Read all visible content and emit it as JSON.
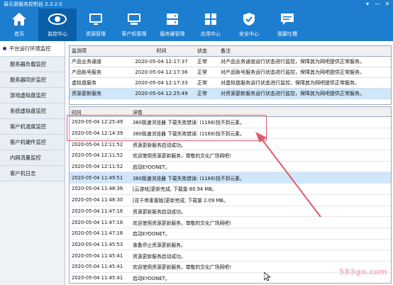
{
  "app": {
    "title": "易乐游服务控制台 2.3.2.0",
    "window_controls": [
      "▾",
      "—",
      "✕"
    ]
  },
  "nav": [
    {
      "label": "首页",
      "icon": "home-icon",
      "active": false
    },
    {
      "label": "监控中心",
      "icon": "eye-icon",
      "active": true
    },
    {
      "label": "资源管理",
      "icon": "monitor-icon",
      "active": false
    },
    {
      "label": "客户机管理",
      "icon": "computer-icon",
      "active": false
    },
    {
      "label": "服务器管理",
      "icon": "server-icon",
      "active": false
    },
    {
      "label": "应用中心",
      "icon": "apps-icon",
      "active": false
    },
    {
      "label": "安全中心",
      "icon": "shield-icon",
      "active": false
    },
    {
      "label": "我要吐槽",
      "icon": "chat-icon",
      "active": false
    }
  ],
  "sidebar": {
    "items": [
      {
        "label": "平台运行环境监控",
        "active": true
      },
      {
        "label": "服务器负载监控",
        "active": false
      },
      {
        "label": "服务器同步监控",
        "active": false
      },
      {
        "label": "游戏虚拟盘监控",
        "active": false
      },
      {
        "label": "系统虚拟盘监控",
        "active": false
      },
      {
        "label": "客户机温度监控",
        "active": false
      },
      {
        "label": "客户机硬件监控",
        "active": false
      },
      {
        "label": "内网流量监控",
        "active": false
      },
      {
        "label": "客户机日志",
        "active": false
      }
    ]
  },
  "monitor_table": {
    "headers": [
      "监测项",
      "时间",
      "状态",
      "备注"
    ],
    "rows": [
      [
        "产品业务通道",
        "2020-05-04 12:17:37",
        "正常",
        "对产品业务通道运行状态进行监控，保障其为网吧提供正常服务。"
      ],
      [
        "产品账号服务",
        "2020-05-04 12:17:36",
        "正常",
        "对产品账号服务运行状态进行监控，保障其为网吧提供正常服务。"
      ],
      [
        "虚拟盘服务",
        "2020-05-04 12:17:33",
        "正常",
        "对虚拟盘服务运行状态进行监控，保障其为网吧提供正常服务。"
      ],
      [
        "资源更新服务",
        "2020-05-04 12:25:49",
        "正常",
        "对资源更新服务运行状态进行监控，保障其为网吧提供正常服务。"
      ]
    ],
    "selected_row": 3
  },
  "log_table": {
    "headers": [
      "时间",
      "详情"
    ],
    "rows": [
      [
        "2020-05-04 12:25:49",
        "360极速浏览器 下载失败错误: (1168)找不到元素。"
      ],
      [
        "2020-05-04 12:14:39",
        "360极速浏览器 下载失败错误: (1168)找不到元素。"
      ],
      [
        "2020-05-04 12:11:52",
        "资源更新服务启动成功。"
      ],
      [
        "2020-05-04 12:11:52",
        "欢迎使用资源更新服务，尊敬的文化广场网吧!"
      ],
      [
        "2020-05-04 12:11:52",
        "启动EYOONET。"
      ],
      [
        "2020-05-04 11:49:51",
        "360极速浏览器 下载失败错误: (1168)找不到元素。"
      ],
      [
        "2020-05-04 11:48:36",
        "[云游戏]更新完成, 下载量 80.94 MB。"
      ],
      [
        "2020-05-04 11:48:30",
        "[花千骨重置版]更新完成, 下载量 2.09 MB。"
      ],
      [
        "2020-05-04 11:47:16",
        "资源更新服务启动成功。"
      ],
      [
        "2020-05-04 11:47:16",
        "欢迎使用资源更新服务，尊敬的文化广场网吧!"
      ],
      [
        "2020-05-04 11:47:16",
        "启动EYOONET。"
      ],
      [
        "2020-05-04 11:45:53",
        "准备停止资源更新服务。"
      ],
      [
        "2020-05-04 11:45:41",
        "资源更新服务启动成功。"
      ],
      [
        "2020-05-04 11:45:41",
        "欢迎使用资源更新服务，尊敬的文化广场网吧!"
      ],
      [
        "2020-05-04 11:45:41",
        "启动EYOONET。"
      ]
    ],
    "selected_row": 5
  },
  "watermark": "583go.com",
  "colors": {
    "header": "#1d7ecf",
    "nav_active": "#0a5fa8",
    "selected_row": "#cfe6fb",
    "annotation": "#e05a6a"
  }
}
